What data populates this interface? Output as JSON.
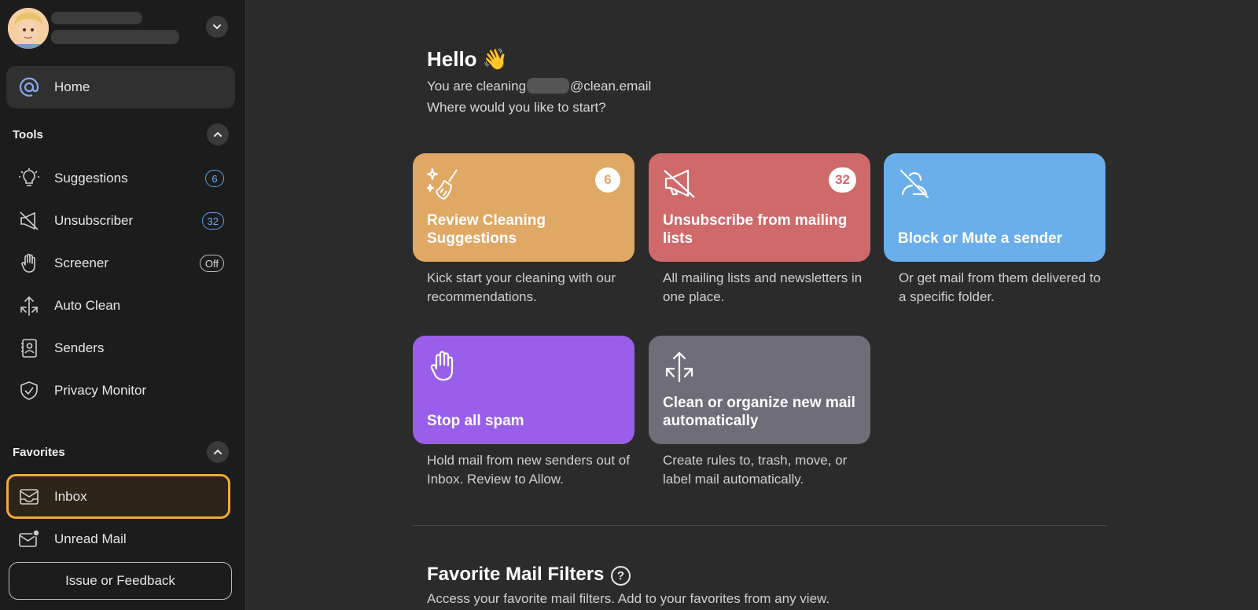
{
  "sidebar": {
    "home_label": "Home",
    "tools_heading": "Tools",
    "tools": [
      {
        "label": "Suggestions",
        "badge": "6"
      },
      {
        "label": "Unsubscriber",
        "badge": "32"
      },
      {
        "label": "Screener",
        "badge": "Off"
      },
      {
        "label": "Auto Clean"
      },
      {
        "label": "Senders"
      },
      {
        "label": "Privacy Monitor"
      }
    ],
    "favorites_heading": "Favorites",
    "favorites": [
      {
        "label": "Inbox"
      },
      {
        "label": "Unread Mail"
      }
    ],
    "feedback_label": "Issue or Feedback"
  },
  "main": {
    "greeting": "Hello 👋",
    "cleaning_prefix": "You are cleaning",
    "cleaning_suffix": "@clean.email",
    "prompt": "Where would you like to start?",
    "cards": [
      {
        "title": "Review Cleaning Suggestions",
        "badge": "6",
        "desc": "Kick start your cleaning with our recommendations.",
        "color": "#dfa865"
      },
      {
        "title": "Unsubscribe from mailing lists",
        "badge": "32",
        "desc": "All mailing lists and newsletters in one place.",
        "color": "#d0696a"
      },
      {
        "title": "Block or Mute a sender",
        "desc": "Or get mail from them delivered to a specific folder.",
        "color": "#6aaeeb"
      },
      {
        "title": "Stop all spam",
        "desc": "Hold mail from new senders out of Inbox. Review to Allow.",
        "color": "#9a5fea"
      },
      {
        "title": "Clean or organize new mail automatically",
        "desc": "Create rules to, trash, move, or label mail automatically.",
        "color": "#6e6d78"
      }
    ],
    "favorites_title": "Favorite Mail Filters",
    "help_glyph": "?",
    "favorites_desc": "Access your favorite mail filters. Add to your favorites from any view."
  },
  "colors": {
    "accent_blue": "#5b9ff0",
    "inbox_highlight": "#f0a93a"
  }
}
